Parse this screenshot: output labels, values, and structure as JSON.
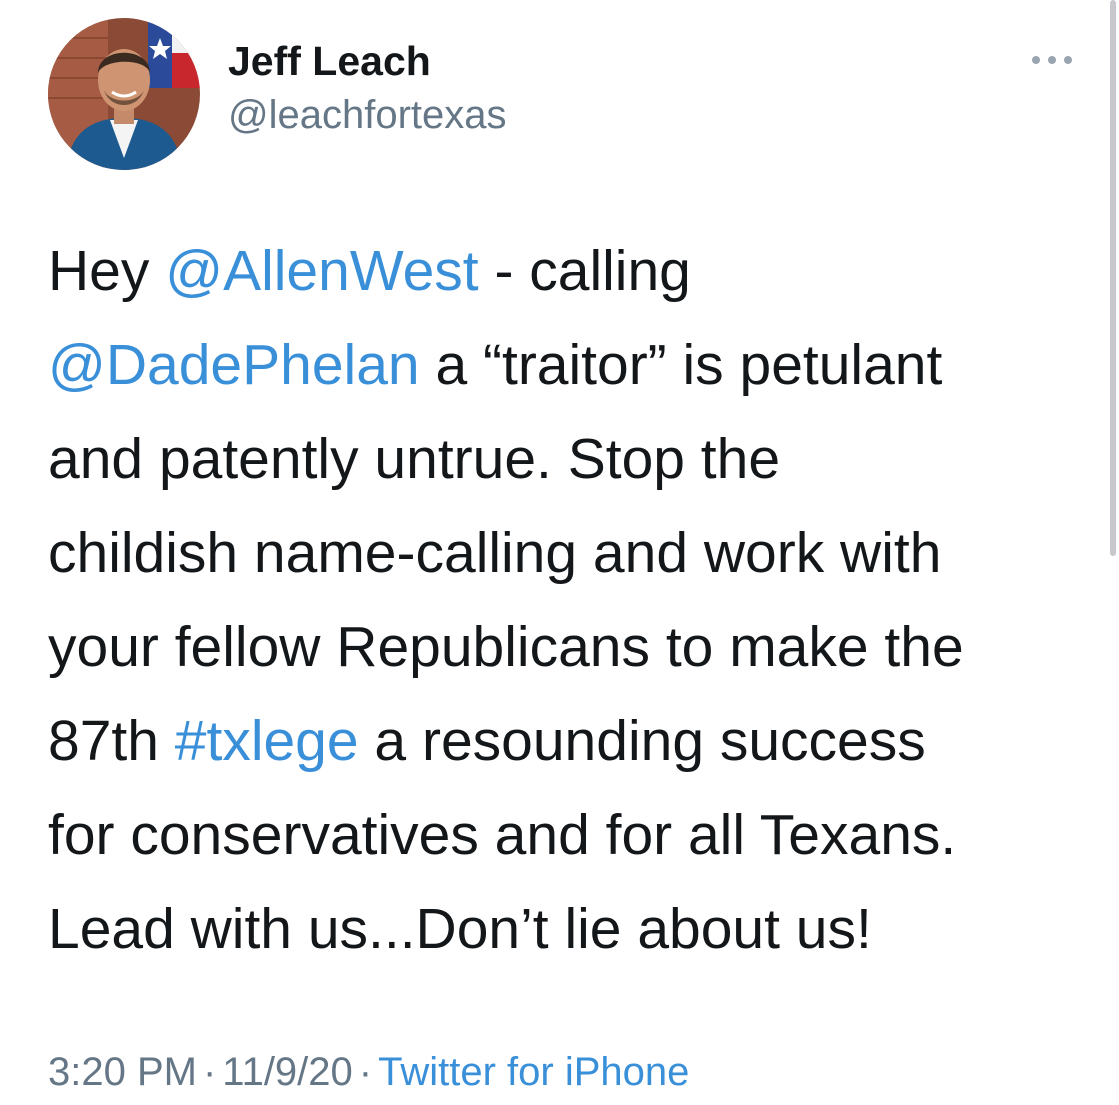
{
  "author": {
    "display_name": "Jeff Leach",
    "handle": "@leachfortexas"
  },
  "icons": {
    "avatar": "profile-photo",
    "more": "more-horizontal-icon"
  },
  "tweet": {
    "lines": [
      [
        {
          "t": "Hey "
        },
        {
          "t": "@AllenWest",
          "link": true
        },
        {
          "t": " - calling"
        }
      ],
      [
        {
          "t": "@DadePhelan",
          "link": true
        },
        {
          "t": " a “traitor” is petulant"
        }
      ],
      [
        {
          "t": "and patently untrue. Stop the"
        }
      ],
      [
        {
          "t": "childish name-calling and work with"
        }
      ],
      [
        {
          "t": "your fellow Republicans to make the"
        }
      ],
      [
        {
          "t": "87th "
        },
        {
          "t": "#txlege",
          "link": true
        },
        {
          "t": " a resounding success"
        }
      ],
      [
        {
          "t": "for conservatives and for all Texans."
        }
      ],
      [
        {
          "t": "Lead with us...Don’t lie about us!"
        }
      ]
    ]
  },
  "meta": {
    "time": "3:20 PM",
    "separator": "·",
    "date": "11/9/20",
    "source": "Twitter for iPhone"
  },
  "colors": {
    "link": "#3a8fd9",
    "secondary_text": "#657786",
    "primary_text": "#14171a"
  }
}
